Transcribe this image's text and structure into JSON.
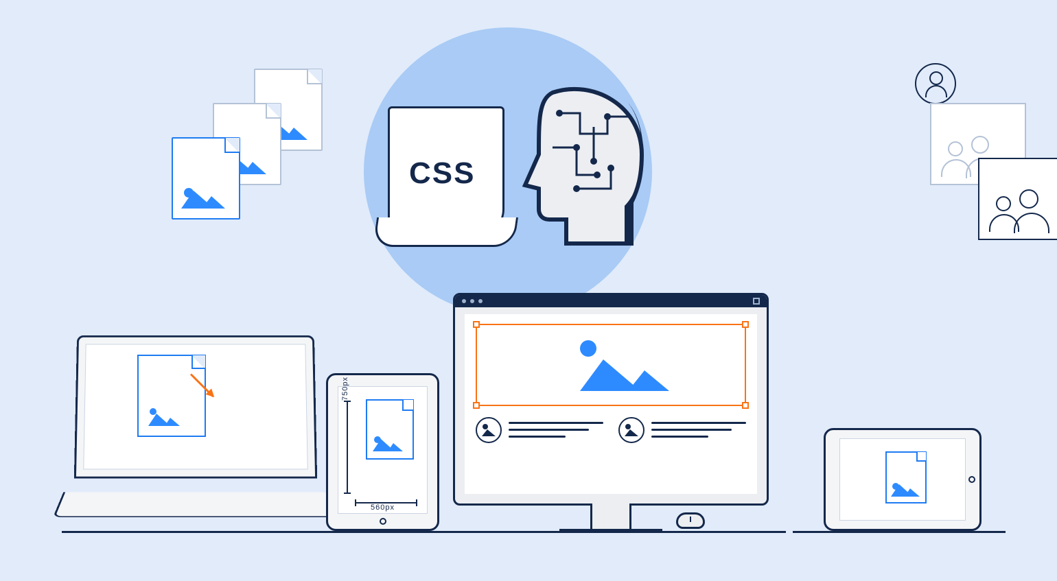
{
  "illustration": {
    "css_label": "CSS",
    "tablet_dimensions": {
      "height_label": "750px",
      "width_label": "560px"
    }
  },
  "colors": {
    "background": "#E1EBFA",
    "circle": "#A9CBF5",
    "navy": "#14284B",
    "blue": "#2D8BFF",
    "bright_blue": "#1E7BF2",
    "orange": "#F97316",
    "grey": "#B4C2D6",
    "offwhite": "#F4F5F7"
  }
}
